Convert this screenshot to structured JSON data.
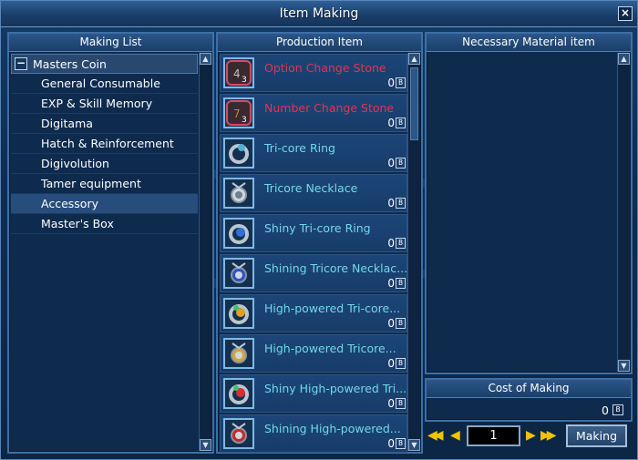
{
  "window": {
    "title": "Item Making",
    "close_label": "×"
  },
  "making_list": {
    "header": "Making List",
    "expand_symbol": "−",
    "items": [
      {
        "label": "Masters Coin"
      },
      {
        "label": "General Consumable"
      },
      {
        "label": "EXP & Skill Memory"
      },
      {
        "label": "Digitama"
      },
      {
        "label": "Hatch & Reinforcement"
      },
      {
        "label": "Digivolution"
      },
      {
        "label": "Tamer equipment"
      },
      {
        "label": "Accessory"
      },
      {
        "label": "Master's Box"
      }
    ],
    "selected_index": 7
  },
  "production": {
    "header": "Production Item",
    "items": [
      {
        "name": "Option Change Stone",
        "count": "0",
        "badge": "B",
        "icon": "option-change-stone-icon",
        "color": "#e03550"
      },
      {
        "name": "Number Change Stone",
        "count": "0",
        "badge": "B",
        "icon": "number-change-stone-icon",
        "color": "#e03550"
      },
      {
        "name": "Tri-core Ring",
        "count": "0",
        "badge": "B",
        "icon": "ring-icon",
        "color": "#6fd9ea"
      },
      {
        "name": "Tricore Necklace",
        "count": "0",
        "badge": "B",
        "icon": "necklace-icon",
        "color": "#6fd9ea"
      },
      {
        "name": "Shiny Tri-core Ring",
        "count": "0",
        "badge": "B",
        "icon": "ring-icon",
        "color": "#6fd9ea"
      },
      {
        "name": "Shining Tricore Necklac...",
        "count": "0",
        "badge": "B",
        "icon": "necklace-icon",
        "color": "#6fd9ea"
      },
      {
        "name": "High-powered Tri-core...",
        "count": "0",
        "badge": "B",
        "icon": "ring-icon",
        "color": "#6fd9ea"
      },
      {
        "name": "High-powered Tricore...",
        "count": "0",
        "badge": "B",
        "icon": "necklace-icon",
        "color": "#6fd9ea"
      },
      {
        "name": "Shiny High-powered Tri...",
        "count": "0",
        "badge": "B",
        "icon": "ring-icon",
        "color": "#6fd9ea"
      },
      {
        "name": "Shining High-powered...",
        "count": "0",
        "badge": "B",
        "icon": "necklace-icon",
        "color": "#6fd9ea"
      }
    ]
  },
  "materials": {
    "header": "Necessary Material item"
  },
  "cost": {
    "header": "Cost of Making",
    "value": "0",
    "badge": "B"
  },
  "controls": {
    "quantity": "1",
    "first_symbol": "◀◀",
    "prev_symbol": "◀",
    "next_symbol": "▶",
    "last_symbol": "▶▶",
    "making_label": "Making"
  },
  "scroll_symbols": {
    "up": "▲",
    "down": "▼"
  }
}
